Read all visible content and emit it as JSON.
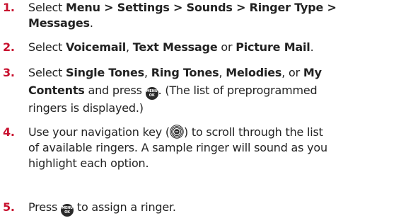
{
  "steps": [
    {
      "number": "1.",
      "line1_pre": "Select ",
      "line1_bold": "Menu > Settings > Sounds > Ringer Type >",
      "line2_bold": "Messages",
      "line2_post": "."
    },
    {
      "number": "2.",
      "pre": "Select ",
      "b1": "Voicemail",
      "mid1": ", ",
      "b2": "Text Message",
      "mid2": " or ",
      "b3": "Picture Mail",
      "post": "."
    },
    {
      "number": "3.",
      "pre": "Select ",
      "b1": "Single Tones",
      "mid1": ", ",
      "b2": "Ring Tones",
      "mid2": ", ",
      "b3": "Melodies",
      "mid3": ", or ",
      "b4": "My",
      "line2_b": "Contents",
      "line2_mid": " and press ",
      "line2_post": ". (The list of preprogrammed",
      "line3": "ringers is displayed.)"
    },
    {
      "number": "4.",
      "line1_pre": "Use your navigation key (",
      "line1_post": ") to scroll through the list",
      "line2": "of available ringers. A sample ringer will sound as you",
      "line3": "highlight each option."
    },
    {
      "number": "5.",
      "pre": "Press ",
      "post": " to assign a ringer."
    }
  ],
  "menu_button": {
    "top": "MENU",
    "bottom": "OK"
  },
  "colors": {
    "step_number": "#c8102e",
    "text": "#222222",
    "button": "#2a2a2a"
  }
}
